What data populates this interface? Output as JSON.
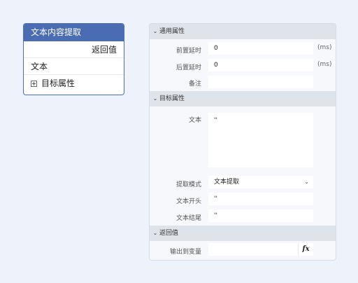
{
  "node": {
    "title": "文本内容提取",
    "output_label": "返回值",
    "input_label": "文本",
    "target_props_label": "目标属性"
  },
  "panel": {
    "general": {
      "header": "通用属性",
      "pre_delay_label": "前置延时",
      "pre_delay_value": "0",
      "pre_delay_unit": "(ms)",
      "post_delay_label": "后置延时",
      "post_delay_value": "0",
      "post_delay_unit": "(ms)",
      "note_label": "备注",
      "note_value": ""
    },
    "target": {
      "header": "目标属性",
      "text_label": "文本",
      "text_value": "''",
      "mode_label": "提取模式",
      "mode_value": "文本提取",
      "start_label": "文本开头",
      "start_value": "''",
      "end_label": "文本结尾",
      "end_value": "''"
    },
    "return": {
      "header": "返回值",
      "output_var_label": "输出到变量",
      "output_var_value": "",
      "fx_button": "fx"
    }
  },
  "icons": {
    "chevron": "chevron-down-icon",
    "plus": "plus-square-icon",
    "fx": "function-fx-icon"
  }
}
